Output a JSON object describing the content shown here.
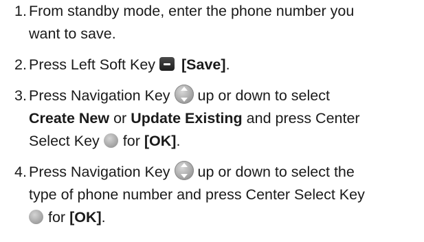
{
  "steps": [
    {
      "num": "1.",
      "line1": "From standby mode, enter the phone number you",
      "line2": "want to save."
    },
    {
      "num": "2.",
      "text_before": "Press Left Soft Key",
      "label": "[Save]",
      "end": "."
    },
    {
      "num": "3.",
      "text_before": "Press Navigation Key",
      "text_after": "up or down to select",
      "option1": "Create New",
      "or": "or",
      "option2": "Update Existing",
      "and_press": "and press Center",
      "select_key": "Select Key",
      "for": "for",
      "label": "[OK]",
      "end": "."
    },
    {
      "num": "4.",
      "text_before": "Press Navigation Key",
      "text_after": "up or down to select the",
      "line2": "type of phone number and press Center Select Key",
      "for": "for",
      "label": "[OK]",
      "end": "."
    }
  ],
  "icons": {
    "soft_key": "left-soft-key-icon",
    "nav_key": "navigation-key-icon",
    "center_key": "center-select-key-icon"
  }
}
